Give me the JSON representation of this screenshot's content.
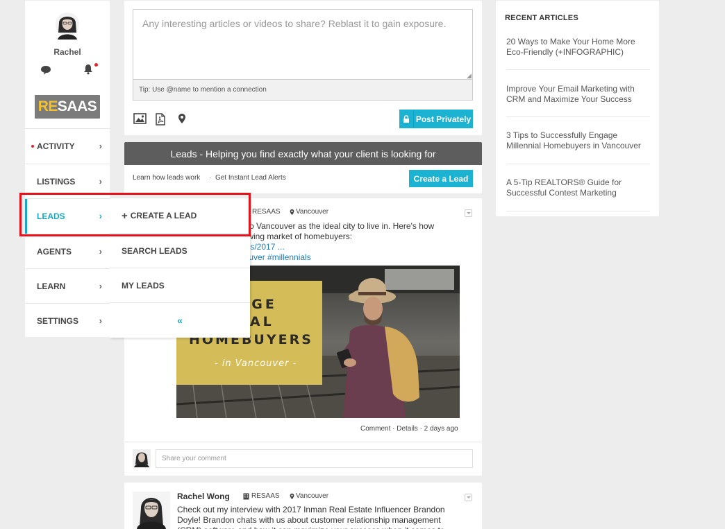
{
  "user": {
    "name": "Rachel"
  },
  "logo": {
    "re": "RE",
    "saas": "SAAS"
  },
  "sidebar": {
    "items": [
      {
        "label": "ACTIVITY",
        "chevron": "›"
      },
      {
        "label": "LISTINGS",
        "chevron": "›"
      },
      {
        "label": "LEADS",
        "chevron": "›"
      },
      {
        "label": "AGENTS",
        "chevron": "›"
      },
      {
        "label": "LEARN",
        "chevron": "›"
      },
      {
        "label": "SETTINGS",
        "chevron": "›"
      }
    ]
  },
  "submenu": {
    "create_lead": "CREATE A LEAD",
    "create_plus": "+",
    "search_leads": "SEARCH LEADS",
    "my_leads": "MY LEADS",
    "collapse": "«"
  },
  "composer": {
    "placeholder": "Any interesting articles or videos to share? Reblast it to gain exposure.",
    "tip": "Tip: Use @name to mention a connection",
    "post_button": "Post Privately"
  },
  "leads": {
    "title": "Leads - Helping you find exactly what your client is looking for",
    "learn_link": "Learn how leads work",
    "separator": "·",
    "alerts_link": "Get Instant Lead Alerts",
    "create_button": "Create a Lead"
  },
  "post1": {
    "company": "RESAAS",
    "location": "Vancouver",
    "line1": "ng to Vancouver as the ideal city to live in. Here's how",
    "line2": " growing market of homebuyers:",
    "link_line": "ticles/2017 ...",
    "hashtags": "ncouver #millennials",
    "image_title_1": "GAGE",
    "image_title_2": "NNIAL",
    "image_title_3": "HOMEBUYERS",
    "image_subtitle": "- in Vancouver -",
    "footer": "Comment · Details · 2 days ago",
    "comment_placeholder": "Share your comment"
  },
  "post2": {
    "author": "Rachel Wong",
    "company": "RESAAS",
    "location": "Vancouver",
    "text": "Check out my interview with 2017 Inman Real Estate Influencer Brandon Doyle! Brandon chats with us about customer relationship management (CRM) software and how it can maximize your success when it comes to"
  },
  "recent": {
    "title": "RECENT ARTICLES",
    "articles": [
      "20 Ways to Make Your Home More Eco-Friendly (+INFOGRAPHIC)",
      "Improve Your Email Marketing with CRM and Maximize Your Success",
      "3 Tips to Successfully Engage Millennial Homebuyers in Vancouver",
      "A 5-Tip REALTORS® Guide for Successful Contest Marketing"
    ]
  },
  "colors": {
    "accent": "#1bb3d1",
    "active_nav": "#19a8c4",
    "notification": "#e4242e",
    "highlight": "#e8101a",
    "banner": "#5d5d5d"
  },
  "icons": [
    "chat-icon",
    "bell-icon",
    "image-icon",
    "pdf-icon",
    "location-pin-icon",
    "lock-icon",
    "building-icon",
    "chevron-right-icon",
    "double-chevron-left-icon"
  ]
}
